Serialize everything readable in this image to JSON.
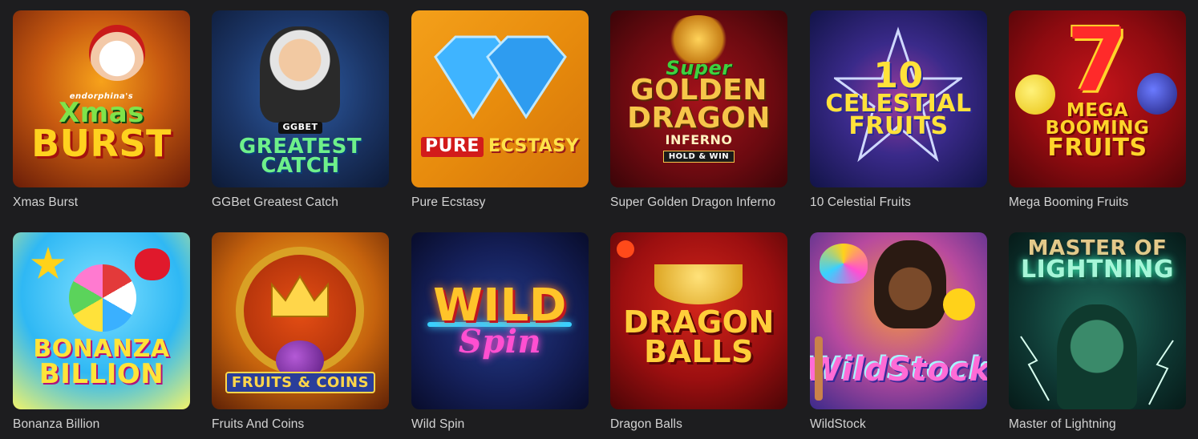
{
  "games": [
    {
      "title": "Xmas Burst",
      "art_lines": [
        "endorphina's",
        "Xmas",
        "BURST"
      ],
      "icon": "santa-icon",
      "accent": "#ffcf2a"
    },
    {
      "title": "GGBet Greatest Catch",
      "art_lines": [
        "GGBET",
        "GREATEST",
        "CATCH"
      ],
      "icon": "fisherman-icon",
      "accent": "#5ee27a"
    },
    {
      "title": "Pure Ecstasy",
      "art_lines": [
        "PURE",
        "ECSTASY"
      ],
      "icon": "diamond-icon",
      "accent": "#ffffff"
    },
    {
      "title": "Super Golden Dragon Inferno",
      "art_lines": [
        "Super",
        "GOLDEN",
        "DRAGON",
        "INFERNO",
        "HOLD & WIN"
      ],
      "icon": "dragon-icon",
      "accent": "#f6c64a"
    },
    {
      "title": "10 Celestial Fruits",
      "art_lines": [
        "10",
        "CELESTIAL",
        "FRUITS"
      ],
      "icon": "star-icon",
      "accent": "#ffe23a"
    },
    {
      "title": "Mega Booming Fruits",
      "art_lines": [
        "7",
        "MEGA BOOMING",
        "FRUITS"
      ],
      "icon": "seven-icon",
      "accent": "#ffd42a"
    },
    {
      "title": "Bonanza Billion",
      "art_lines": [
        "BONANZA",
        "BILLION"
      ],
      "icon": "candy-icon",
      "accent": "#ffe43a"
    },
    {
      "title": "Fruits And Coins",
      "art_lines": [
        "FRUITS & COINS"
      ],
      "icon": "crown-icon",
      "accent": "#ffd64a"
    },
    {
      "title": "Wild Spin",
      "art_lines": [
        "WILD",
        "Spin"
      ],
      "icon": "neon-icon",
      "accent": "#ff4fd1"
    },
    {
      "title": "Dragon Balls",
      "art_lines": [
        "DRAGON",
        "BALLS"
      ],
      "icon": "ingot-icon",
      "accent": "#ffce3a"
    },
    {
      "title": "WildStock",
      "art_lines": [
        "WildStock"
      ],
      "icon": "guitar-icon",
      "accent": "#ff6bd6"
    },
    {
      "title": "Master of Lightning",
      "art_lines": [
        "MASTER OF",
        "LIGHTNING"
      ],
      "icon": "lightning-icon",
      "accent": "#a6f6d8"
    }
  ]
}
